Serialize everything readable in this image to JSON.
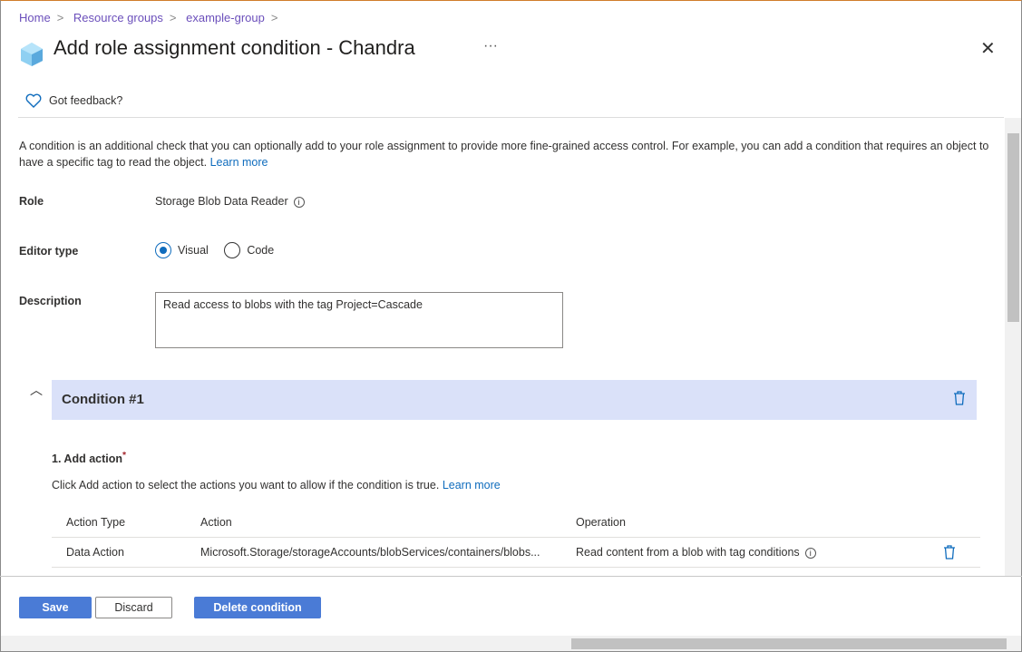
{
  "breadcrumb": [
    "Home",
    "Resource groups",
    "example-group"
  ],
  "title": "Add role assignment condition - Chandra",
  "more": "···",
  "feedback": "Got feedback?",
  "intro": "A condition is an additional check that you can optionally add to your role assignment to provide more fine-grained access control. For example, you can add a condition that requires an object to have a specific tag to read the object.",
  "learn_more": "Learn more",
  "role": {
    "label": "Role",
    "value": "Storage Blob Data Reader"
  },
  "editor": {
    "label": "Editor type",
    "options": [
      "Visual",
      "Code"
    ],
    "selected": "Visual"
  },
  "description": {
    "label": "Description",
    "value": "Read access to blobs with the tag Project=Cascade"
  },
  "condition": {
    "title": "Condition #1",
    "step": "1. Add action",
    "required": "*",
    "help": "Click Add action to select the actions you want to allow if the condition is true.",
    "columns": [
      "Action Type",
      "Action",
      "Operation"
    ],
    "rows": [
      {
        "type": "Data Action",
        "action": "Microsoft.Storage/storageAccounts/blobServices/containers/blobs...",
        "operation": "Read content from a blob with tag conditions"
      }
    ]
  },
  "footer": {
    "save": "Save",
    "discard": "Discard",
    "delete": "Delete condition"
  }
}
